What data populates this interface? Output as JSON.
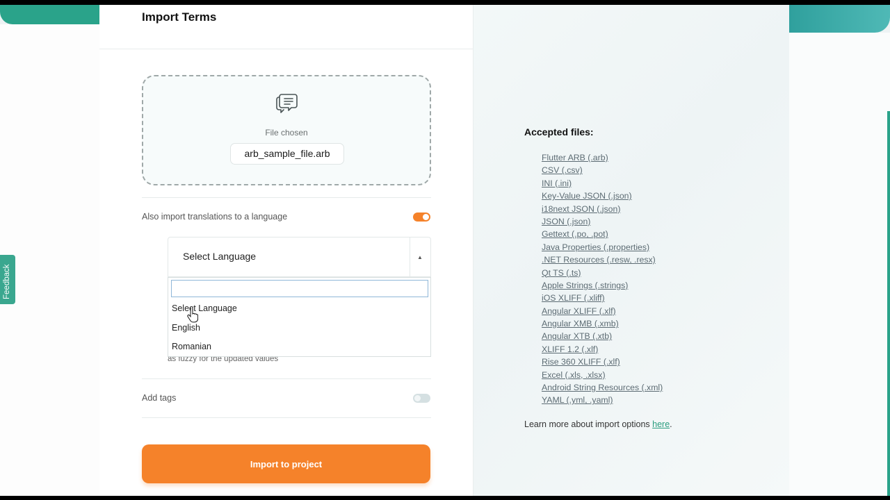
{
  "modal": {
    "title": "Import Terms",
    "dropzone": {
      "status": "File chosen",
      "file_name": "arb_sample_file.arb",
      "icon": "document-chat-icon"
    },
    "also_import": {
      "label": "Also import translations to a language",
      "enabled": true
    },
    "language_select": {
      "value": "Select Language",
      "expanded": true,
      "search_value": ""
    },
    "language_options": [
      "Select Language",
      "English",
      "Romanian"
    ],
    "partial_hidden_text": "as fuzzy for the updated values",
    "add_tags": {
      "label": "Add tags",
      "enabled": false
    },
    "import_button": "Import to project"
  },
  "accepted": {
    "title": "Accepted files:",
    "files": [
      "Flutter ARB (.arb)",
      "CSV (.csv)",
      "INI (.ini)",
      "Key-Value JSON (.json)",
      "i18next JSON (.json)",
      "JSON (.json)",
      "Gettext (.po, .pot)",
      "Java Properties (.properties)",
      ".NET Resources (.resw, .resx)",
      "Qt TS (.ts)",
      "Apple Strings (.strings)",
      "iOS XLIFF (.xliff)",
      "Angular XLIFF (.xlf)",
      "Angular XMB (.xmb)",
      "Angular XTB (.xtb)",
      "XLIFF 1.2 (.xlf)",
      "Rise 360 XLIFF (.xlf)",
      "Excel (.xls, .xlsx)",
      "Android String Resources (.xml)",
      "YAML (.yml, .yaml)"
    ],
    "learn_more_prefix": "Learn more about import options ",
    "learn_more_link": "here",
    "learn_more_suffix": "."
  },
  "feedback_tab": "Feedback",
  "colors": {
    "accent_orange": "#f5822a",
    "brand_teal": "#2aa38a"
  }
}
